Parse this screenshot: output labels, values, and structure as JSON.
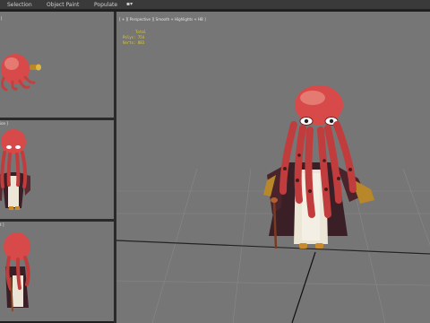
{
  "menubar": {
    "items": [
      {
        "label": "Selection"
      },
      {
        "label": "Object Paint"
      },
      {
        "label": "Populate"
      }
    ],
    "dropdown_icon": "display-toggle-icon"
  },
  "viewports": {
    "top_left_label": "[",
    "mid_left_label": "ion ]",
    "bot_left_label": "t ]",
    "main_label": "[ + ][ Perspective ][ Smooth + Highlights + HB ]"
  },
  "stats": {
    "heading": "Total",
    "polys_label": "Polys: 754",
    "verts_label": "Verts: 883"
  },
  "colors": {
    "viewport_bg": "#767676",
    "stats_text": "#e5cf2a",
    "octopus_skin": "#d84a4a",
    "robe": "#3a2026"
  }
}
